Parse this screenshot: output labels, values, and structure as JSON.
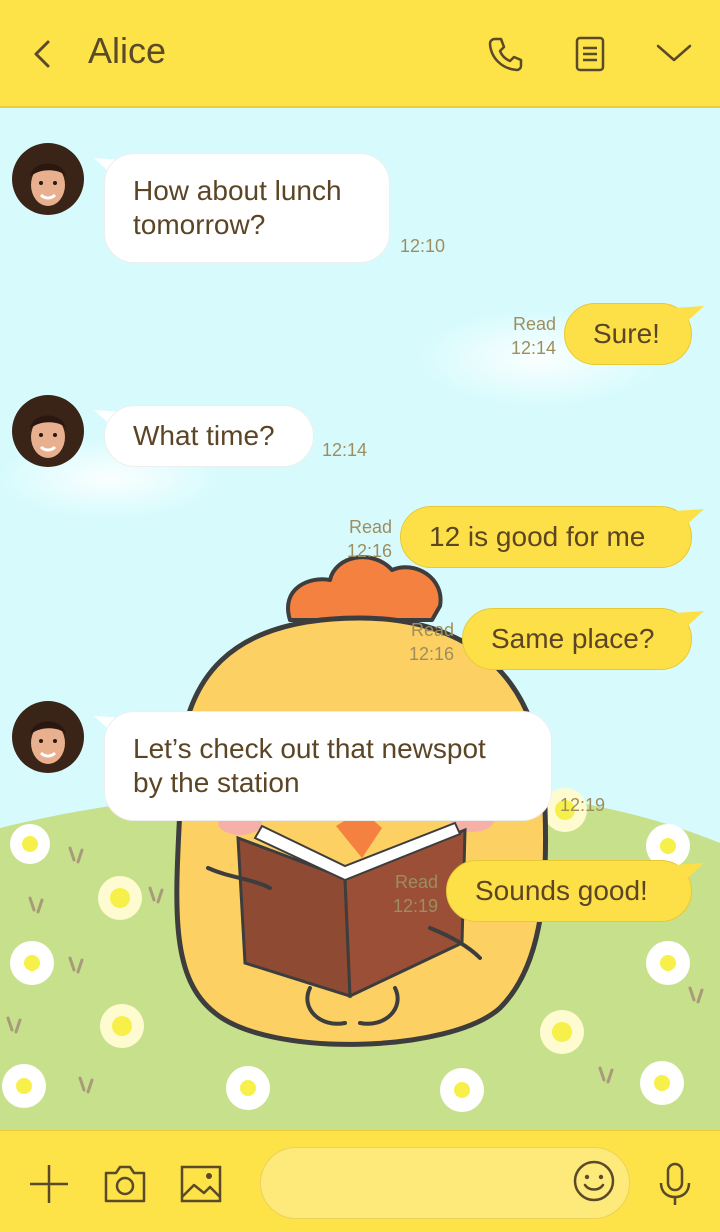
{
  "header": {
    "contact_name": "Alice",
    "icons": [
      "back-icon",
      "phone-icon",
      "notes-icon",
      "chevron-down-icon"
    ]
  },
  "messages": [
    {
      "direction": "in",
      "text": "How about lunch tomorrow?",
      "time": "12:10"
    },
    {
      "direction": "out",
      "text": "Sure!",
      "status": "Read",
      "time": "12:14"
    },
    {
      "direction": "in",
      "text": "What time?",
      "time": "12:14"
    },
    {
      "direction": "out",
      "text": "12 is good for me",
      "status": "Read",
      "time": "12:16"
    },
    {
      "direction": "out",
      "text": "Same place?",
      "status": "Read",
      "time": "12:16"
    },
    {
      "direction": "in",
      "text": "Let’s check out that newspot by the station",
      "time": "12:19"
    },
    {
      "direction": "out",
      "text": "Sounds good!",
      "status": "Read",
      "time": "12:19"
    }
  ],
  "footer": {
    "input_value": "",
    "icons": [
      "plus-icon",
      "camera-icon",
      "image-icon",
      "emoji-icon",
      "microphone-icon"
    ]
  },
  "colors": {
    "header_bg": "#fde348",
    "chat_bg": "#d7fbfd",
    "out_bubble": "#fde048",
    "in_bubble": "#ffffff",
    "text": "#5c4525"
  }
}
